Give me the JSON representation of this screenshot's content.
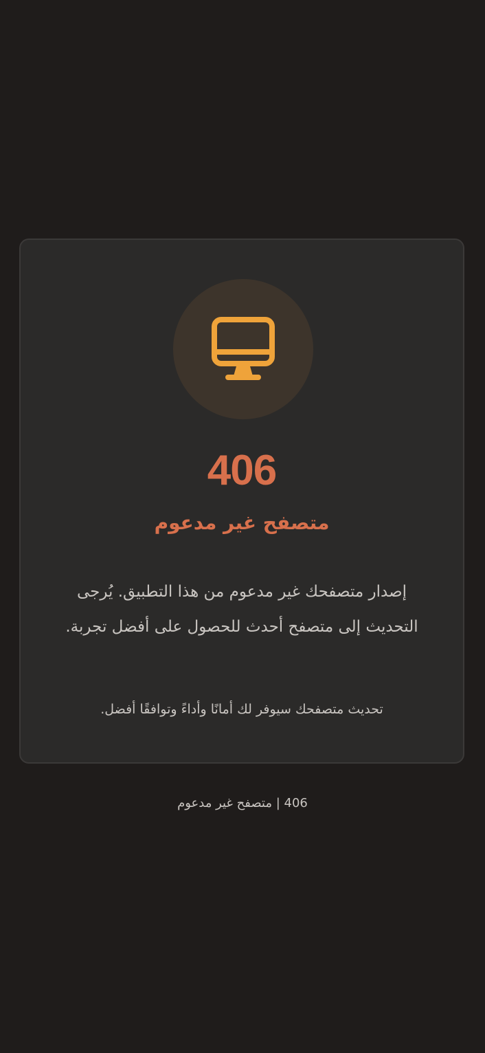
{
  "colors": {
    "background": "#1f1c1b",
    "card": "#2b2a29",
    "card_border": "#3b3938",
    "icon_circle": "#3d342b",
    "icon": "#efa33a",
    "accent": "#d8704c",
    "text": "#c9c5c1"
  },
  "icon": "monitor-icon",
  "error": {
    "code": "406",
    "title": "متصفح غير مدعوم",
    "description": "إصدار متصفحك غير مدعوم من هذا التطبيق. يُرجى التحديث إلى متصفح أحدث للحصول على أفضل تجربة.",
    "note": "تحديث متصفحك سيوفر لك أمانًا وأداءً وتوافقًا أفضل."
  },
  "footer": {
    "text": "406 | متصفح غير مدعوم"
  }
}
